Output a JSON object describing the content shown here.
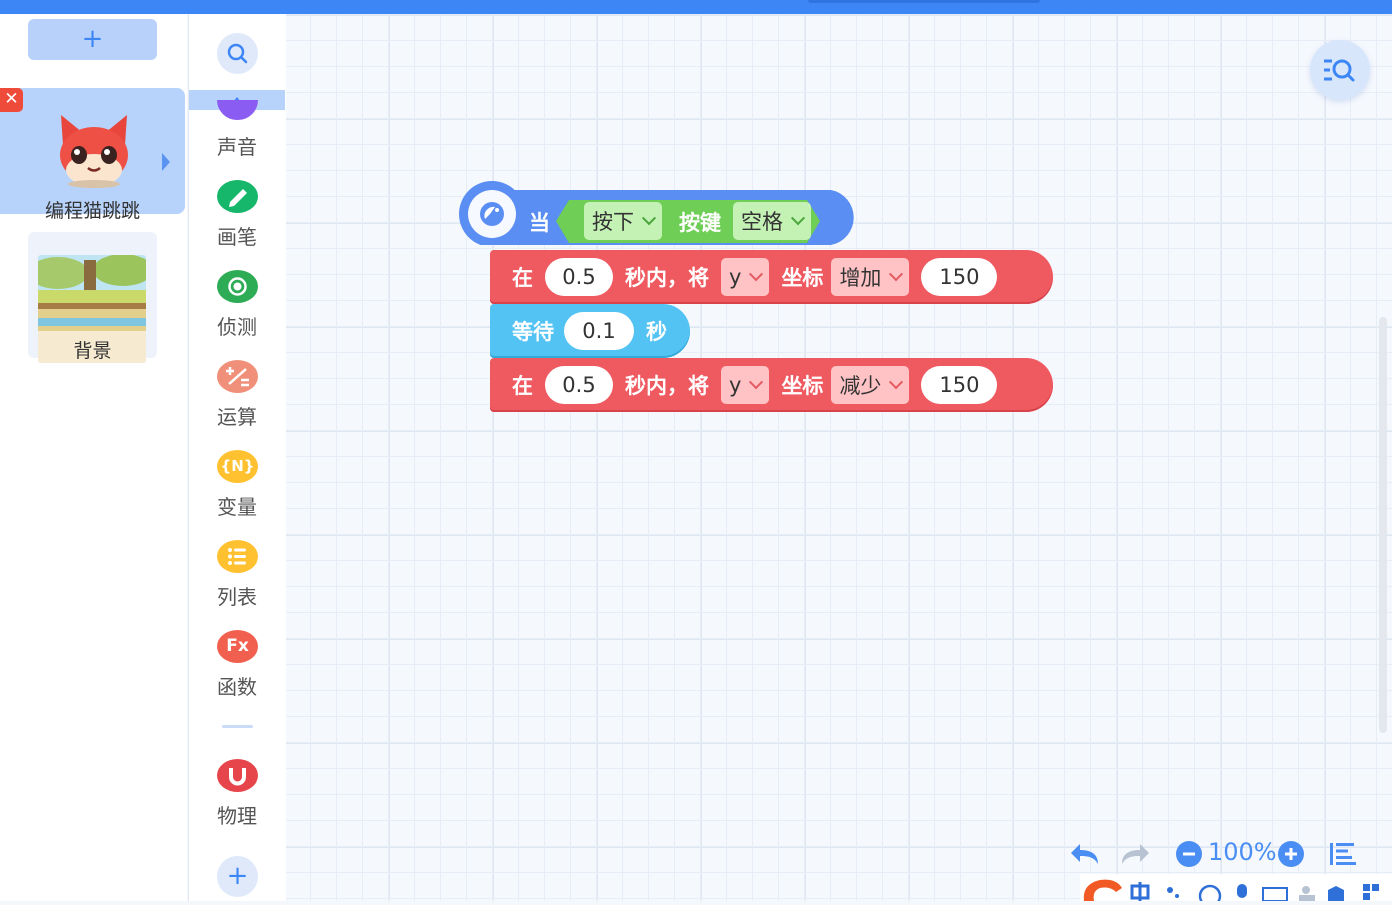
{
  "sprite_panel": {
    "add_label": "+",
    "sprites": [
      {
        "name": "编程猫跳跳",
        "selected": true
      }
    ],
    "background": {
      "name": "背景"
    }
  },
  "categories": [
    {
      "label": "声音",
      "color": "#8a5cf2",
      "icon": "music-icon"
    },
    {
      "label": "画笔",
      "color": "#16b66b",
      "icon": "pen-icon"
    },
    {
      "label": "侦测",
      "color": "#2eab55",
      "icon": "radar-icon"
    },
    {
      "label": "运算",
      "color": "#f0907a",
      "icon": "operators-icon"
    },
    {
      "label": "变量",
      "color": "#ffc130",
      "icon_text": "{N}",
      "icon": "variable-icon"
    },
    {
      "label": "列表",
      "color": "#ffc130",
      "icon": "list-icon"
    },
    {
      "label": "函数",
      "color": "#f1604f",
      "icon_text": "Fx",
      "icon": "function-icon"
    },
    {
      "label": "物理",
      "color": "#e6454c",
      "icon": "magnet-icon"
    }
  ],
  "blocks": {
    "hat": {
      "when": "当",
      "action": "按下",
      "key_label": "按键",
      "key": "空格"
    },
    "move1": {
      "in": "在",
      "duration": "0.5",
      "seconds_within": "秒内，将",
      "axis": "y",
      "coord": "坐标",
      "op": "增加",
      "amount": "150"
    },
    "wait": {
      "label": "等待",
      "duration": "0.1",
      "unit": "秒"
    },
    "move2": {
      "in": "在",
      "duration": "0.5",
      "seconds_within": "秒内，将",
      "axis": "y",
      "coord": "坐标",
      "op": "减少",
      "amount": "150"
    }
  },
  "zoom": {
    "level": "100%"
  },
  "colors": {
    "accent": "#3d86f5",
    "motion": "#ef5a61",
    "control": "#53c3f3",
    "event": "#5b8ef3",
    "key_green": "#6fce56"
  }
}
